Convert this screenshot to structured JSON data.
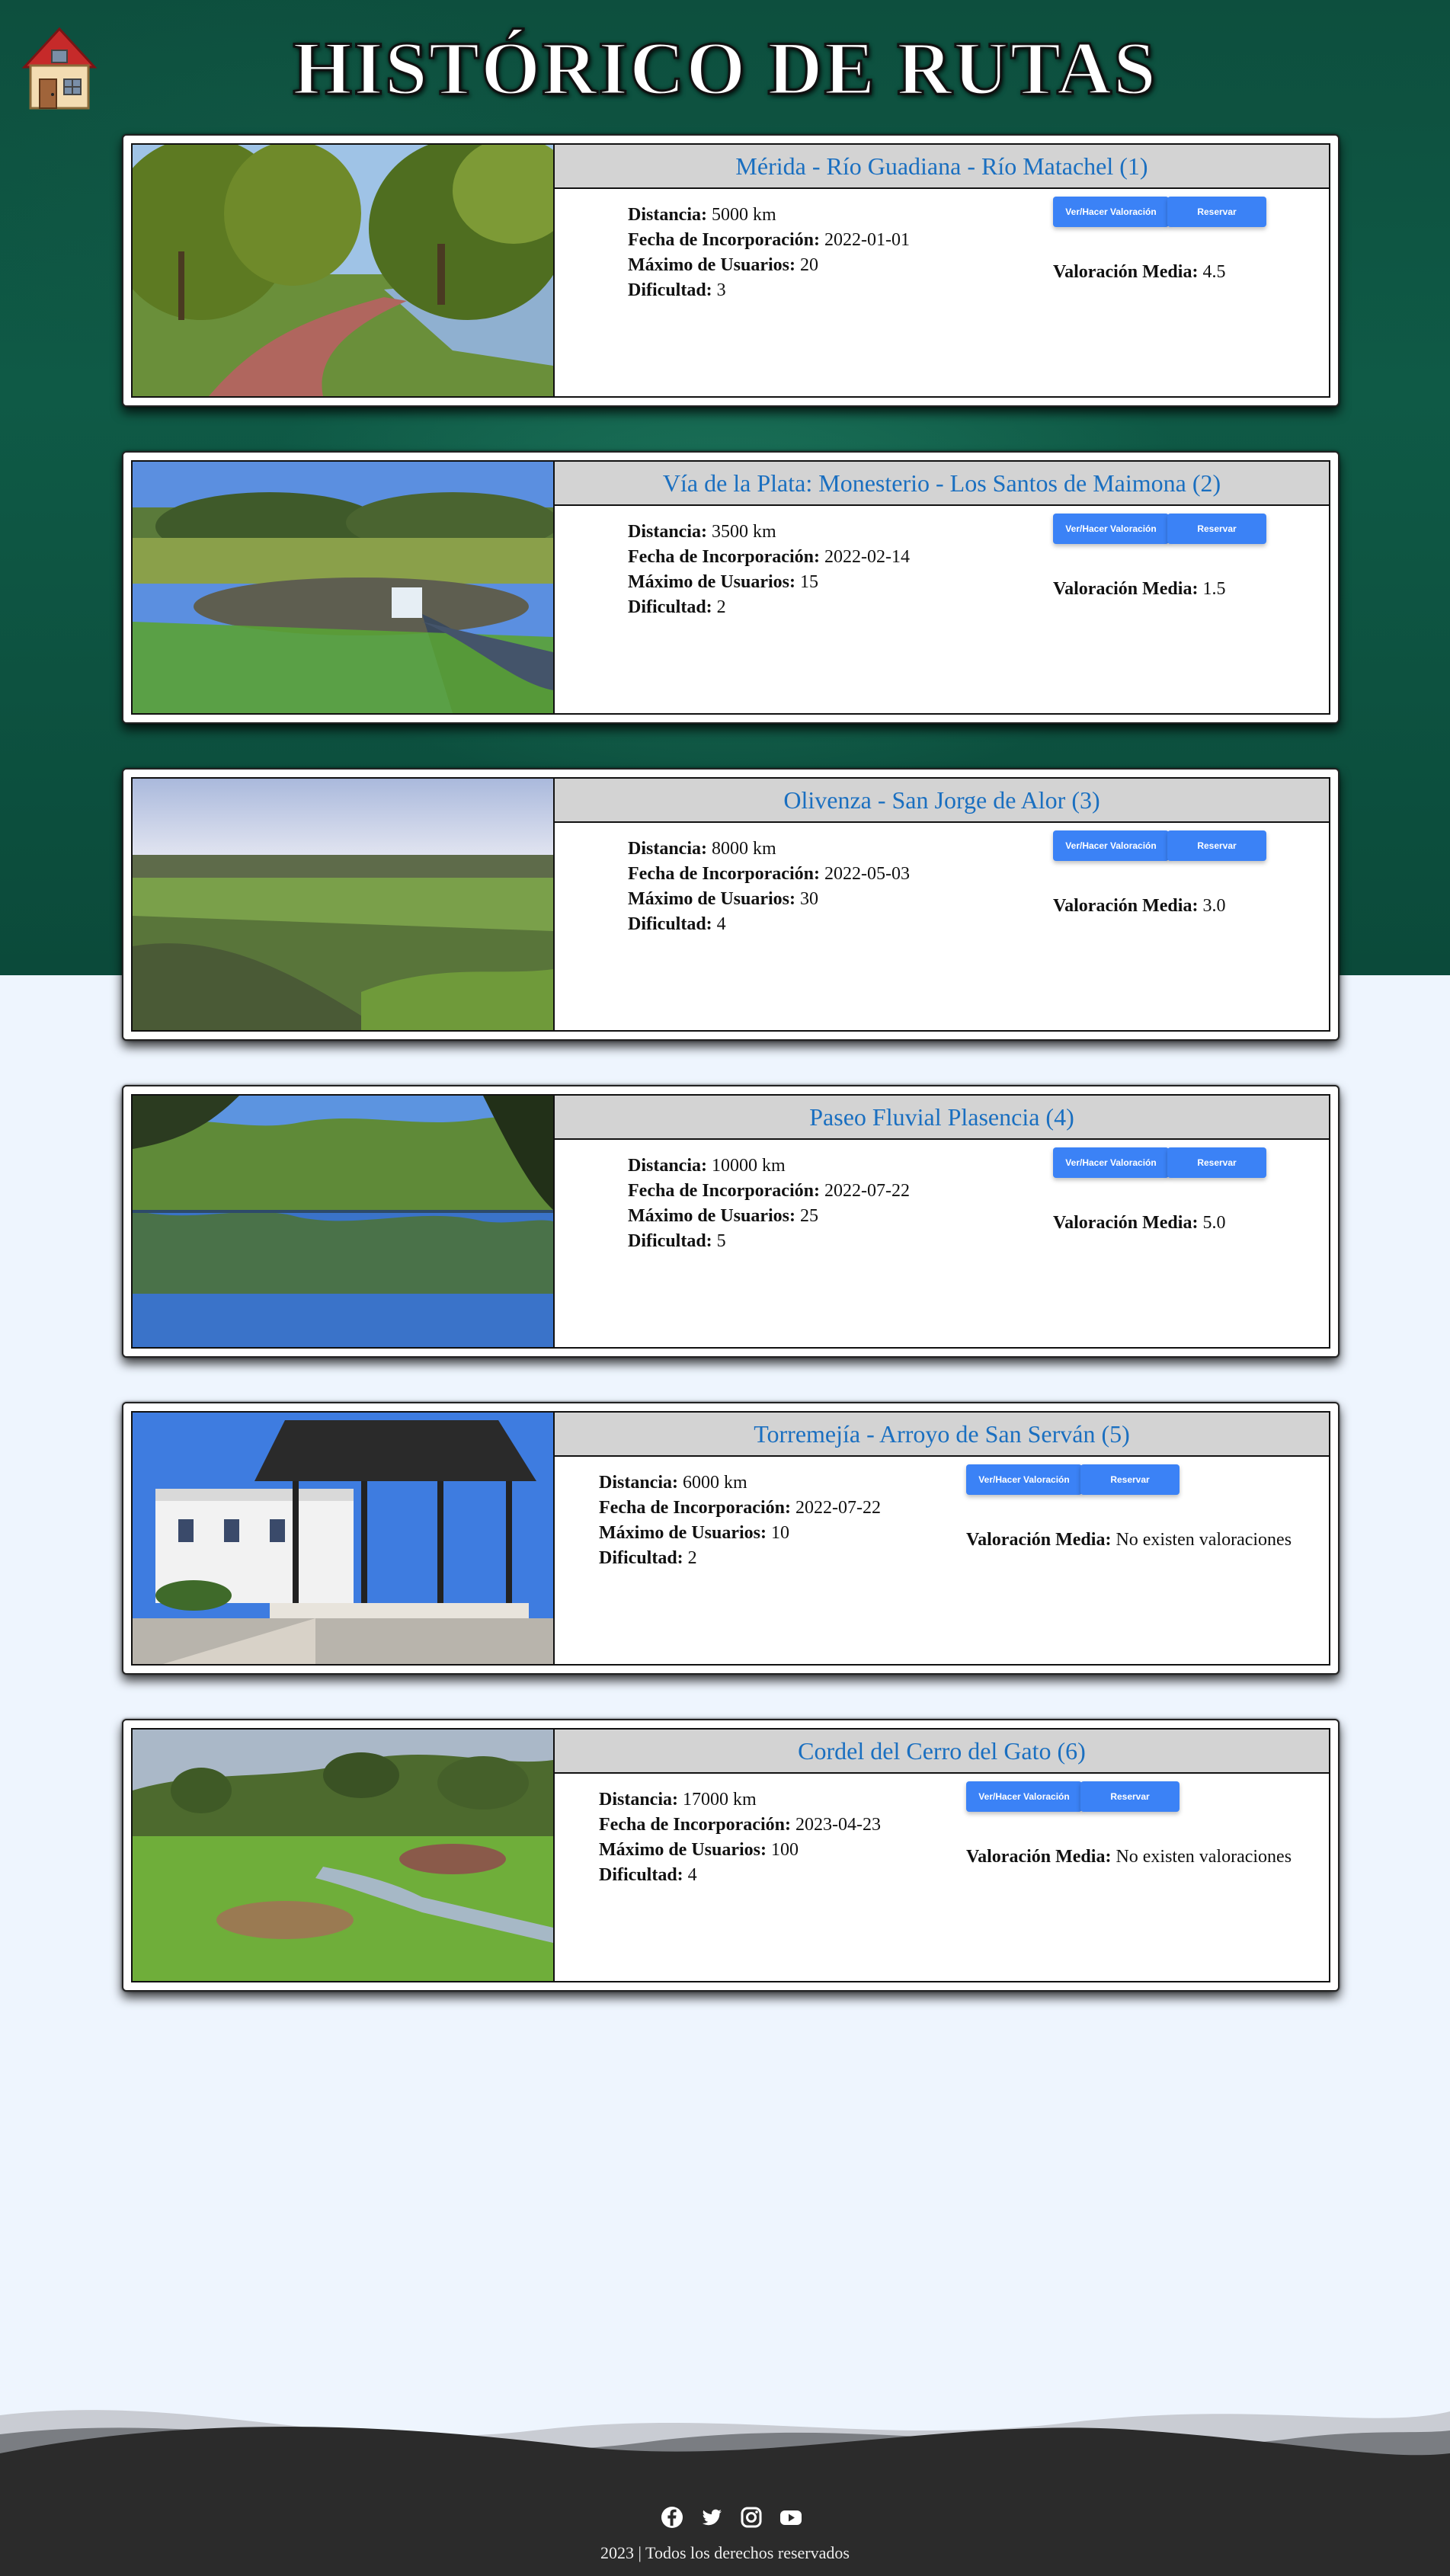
{
  "header": {
    "title": "HISTÓRICO DE RUTAS",
    "home_icon": "house-icon"
  },
  "labels": {
    "distance": "Distancia:",
    "date": "Fecha de Incorporación:",
    "max_users": "Máximo de Usuarios:",
    "difficulty": "Dificultad:",
    "rating": "Valoración Media:",
    "rate_button": "Ver/Hacer Valoración",
    "book_button": "Reservar"
  },
  "routes": [
    {
      "title": "Mérida - Río Guadiana - Río Matachel (1)",
      "distance": "5000 km",
      "date": "2022-01-01",
      "max_users": "20",
      "difficulty": "3",
      "rating": "4.5"
    },
    {
      "title": "Vía de la Plata: Monesterio - Los Santos de Maimona (2)",
      "distance": "3500 km",
      "date": "2022-02-14",
      "max_users": "15",
      "difficulty": "2",
      "rating": "1.5"
    },
    {
      "title": "Olivenza - San Jorge de Alor (3)",
      "distance": "8000 km",
      "date": "2022-05-03",
      "max_users": "30",
      "difficulty": "4",
      "rating": "3.0"
    },
    {
      "title": "Paseo Fluvial Plasencia (4)",
      "distance": "10000 km",
      "date": "2022-07-22",
      "max_users": "25",
      "difficulty": "5",
      "rating": "5.0"
    },
    {
      "title": "Torremejía - Arroyo de San Serván (5)",
      "distance": "6000 km",
      "date": "2022-07-22",
      "max_users": "10",
      "difficulty": "2",
      "rating": "No existen valoraciones"
    },
    {
      "title": "Cordel del Cerro del Gato (6)",
      "distance": "17000 km",
      "date": "2023-04-23",
      "max_users": "100",
      "difficulty": "4",
      "rating": "No existen valoraciones"
    }
  ],
  "footer": {
    "social_icons": [
      "facebook-icon",
      "twitter-icon",
      "instagram-icon",
      "youtube-icon"
    ],
    "copyright": "2023 | Todos los derechos reservados"
  },
  "colors": {
    "header_green": "#0f5a46",
    "title_blue": "#1a6fc0",
    "button_blue": "#3b82f6",
    "footer_dark": "#2b2b2b"
  }
}
